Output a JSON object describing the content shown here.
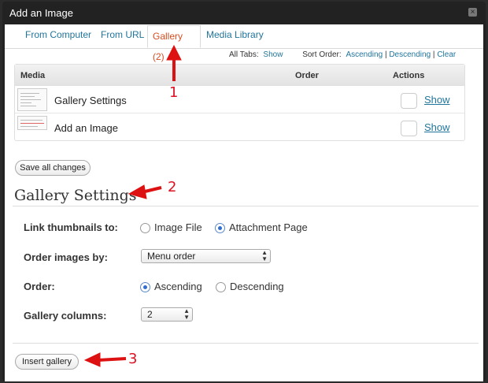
{
  "window": {
    "title": "Add an Image",
    "close_icon": "×"
  },
  "tabs": [
    {
      "label": "From Computer"
    },
    {
      "label": "From URL"
    },
    {
      "label": "Gallery (2)"
    },
    {
      "label": "Media Library"
    }
  ],
  "sort_bar": {
    "all_tabs_label": "All Tabs:",
    "show_link": "Show",
    "sort_order_label": "Sort Order:",
    "ascending": "Ascending",
    "descending": "Descending",
    "clear": "Clear",
    "separator": "|"
  },
  "media_table": {
    "headers": {
      "media": "Media",
      "order": "Order",
      "actions": "Actions"
    },
    "rows": [
      {
        "name": "Gallery Settings",
        "action": "Show"
      },
      {
        "name": "Add an Image",
        "action": "Show"
      }
    ]
  },
  "save_button": "Save all changes",
  "gallery_settings": {
    "heading": "Gallery Settings",
    "link_thumbnails": {
      "label": "Link thumbnails to:",
      "options": [
        "Image File",
        "Attachment Page"
      ],
      "selected": "Attachment Page"
    },
    "order_by": {
      "label": "Order images by:",
      "value": "Menu order"
    },
    "order": {
      "label": "Order:",
      "options": [
        "Ascending",
        "Descending"
      ],
      "selected": "Ascending"
    },
    "columns": {
      "label": "Gallery columns:",
      "value": "2"
    }
  },
  "insert_button": "Insert gallery",
  "annotations": [
    "1",
    "2",
    "3"
  ],
  "colors": {
    "accent": "#21759b",
    "active_tab": "#d54e21",
    "annotation": "#dd1111"
  }
}
